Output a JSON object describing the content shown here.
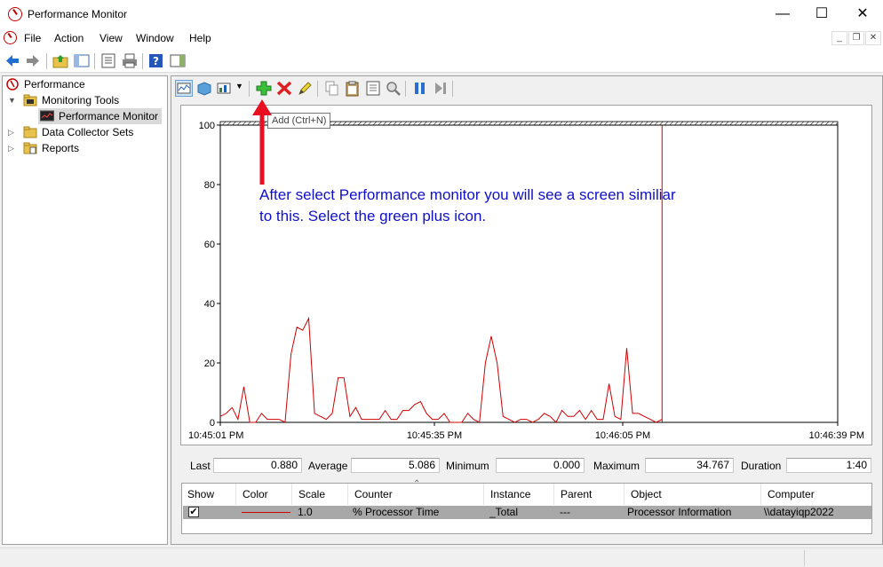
{
  "window": {
    "title": "Performance Monitor"
  },
  "menu": [
    "File",
    "Action",
    "View",
    "Window",
    "Help"
  ],
  "tree": {
    "root": "Performance",
    "monitoring_tools": "Monitoring Tools",
    "performance_monitor": "Performance Monitor",
    "data_collector_sets": "Data Collector Sets",
    "reports": "Reports"
  },
  "tooltip": "Add (Ctrl+N)",
  "annotation": "After select Performance monitor you will see a screen similiar to this. Select the green plus icon.",
  "stats": {
    "last_label": "Last",
    "last_value": "0.880",
    "average_label": "Average",
    "average_value": "5.086",
    "minimum_label": "Minimum",
    "minimum_value": "0.000",
    "maximum_label": "Maximum",
    "maximum_value": "34.767",
    "duration_label": "Duration",
    "duration_value": "1:40"
  },
  "legend": {
    "headers": [
      "Show",
      "Color",
      "Scale",
      "Counter",
      "Instance",
      "Parent",
      "Object",
      "Computer"
    ],
    "row": {
      "scale": "1.0",
      "counter": "% Processor Time",
      "instance": "_Total",
      "parent": "---",
      "object": "Processor Information",
      "computer": "\\\\datayiqp2022",
      "color": "#d00000"
    }
  },
  "chart_data": {
    "type": "line",
    "ylim": [
      0,
      100
    ],
    "y_ticks": [
      "0",
      "20",
      "40",
      "60",
      "80",
      "100"
    ],
    "x_tick_labels": [
      "10:45:01 PM",
      "10:45:35 PM",
      "10:46:05 PM",
      "10:46:39 PM"
    ],
    "series": [
      {
        "color": "#d00000",
        "values": [
          2,
          3,
          5,
          1,
          12,
          0,
          0,
          3,
          1,
          1,
          1,
          0,
          23,
          32,
          31,
          35,
          3,
          2,
          1,
          3,
          15,
          15,
          2,
          5,
          1,
          1,
          1,
          1,
          4,
          1,
          1,
          4,
          4,
          6,
          7,
          3,
          1,
          1,
          3,
          0,
          0,
          0,
          3,
          1,
          0,
          20,
          29,
          20,
          2,
          1,
          0,
          1,
          1,
          0,
          1,
          3,
          2,
          0,
          4,
          2,
          2,
          4,
          1,
          4,
          1,
          1,
          13,
          2,
          1,
          25,
          3,
          3,
          2,
          1,
          0,
          1
        ]
      }
    ],
    "current_position_index": 75,
    "grid": false
  }
}
